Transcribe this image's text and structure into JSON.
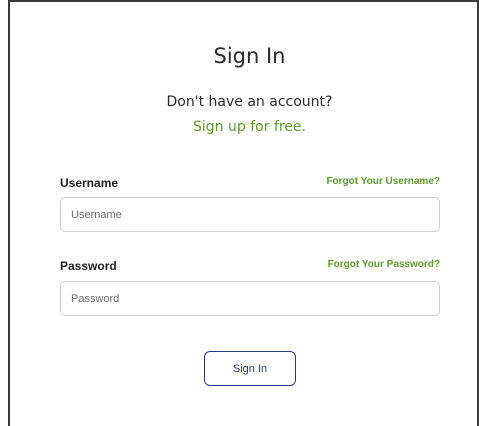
{
  "login": {
    "title": "Sign In",
    "no_account_text": "Don't have an account?",
    "signup_link": "Sign up for free.",
    "username": {
      "label": "Username",
      "forgot_link": "Forgot Your Username?",
      "placeholder": "Username",
      "value": ""
    },
    "password": {
      "label": "Password",
      "forgot_link": "Forgot Your Password?",
      "placeholder": "Password",
      "value": ""
    },
    "submit_label": "Sign In"
  },
  "colors": {
    "accent_green": "#5b9a2f",
    "button_navy": "#2b3a7a",
    "input_border": "#cfd3d8",
    "text_dark": "#2a2a2a"
  }
}
